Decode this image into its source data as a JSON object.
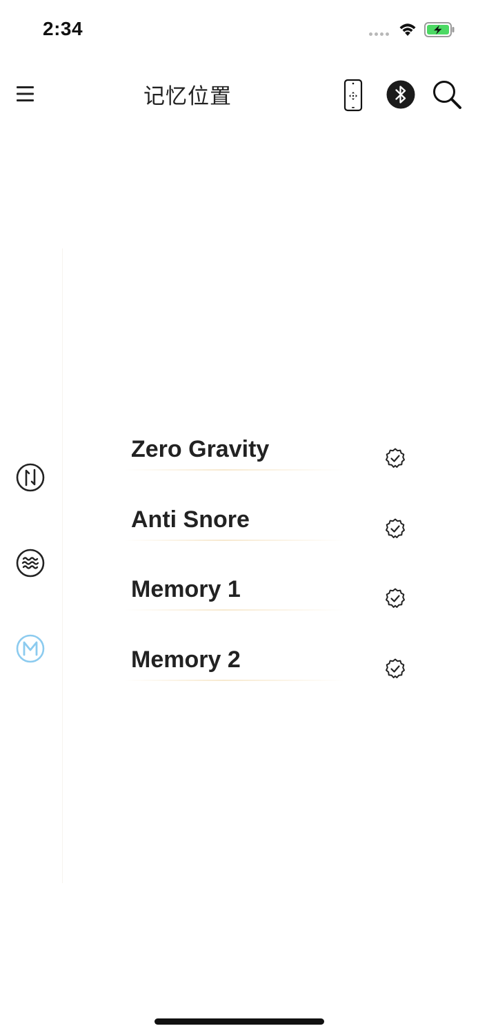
{
  "status_bar": {
    "time": "2:34",
    "battery_color": "#4cd964"
  },
  "header": {
    "title": "记忆位置",
    "icons": [
      "menu-icon",
      "remote-control-icon",
      "bluetooth-icon",
      "search-icon"
    ]
  },
  "mode_rail": {
    "items": [
      {
        "name": "massage-mode-icon",
        "active": false
      },
      {
        "name": "wave-mode-icon",
        "active": false
      },
      {
        "name": "memory-mode-icon",
        "active": true
      }
    ],
    "active_color": "#8ccbef"
  },
  "memory_list": {
    "items": [
      {
        "label": "Zero Gravity"
      },
      {
        "label": "Anti Snore"
      },
      {
        "label": "Memory 1"
      },
      {
        "label": "Memory 2"
      }
    ]
  }
}
